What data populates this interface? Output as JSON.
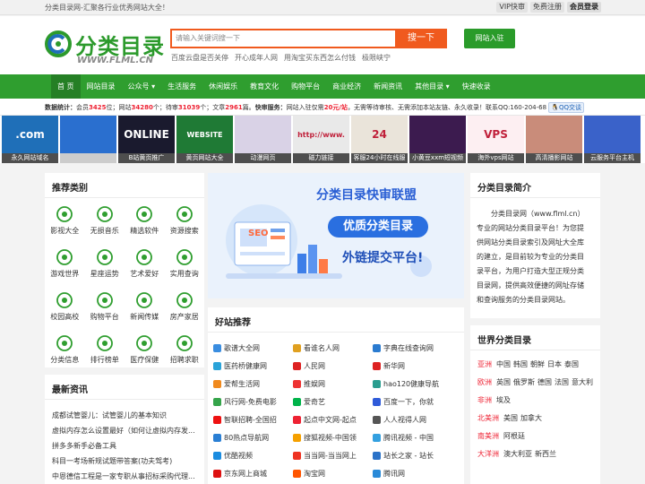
{
  "topbar": {
    "slogan": "分类目录网-汇聚各行业优秀网站大全！",
    "links": [
      "VIP快审",
      "免费注册",
      "会员登录"
    ]
  },
  "header": {
    "logo_cn": "分类目录",
    "logo_url": "WWW.FLML.CN",
    "search_placeholder": "请输入关键词搜一下",
    "search_button": "搜一下",
    "hotwords": [
      "百度云盘是否关停",
      "开心成年人网",
      "用淘宝买东西怎么付钱",
      "极限峡宁"
    ],
    "join_button": "网站入驻"
  },
  "nav": {
    "items": [
      "首 页",
      "网站目录",
      "公众号 ▾",
      "生活服务",
      "休闲娱乐",
      "教育文化",
      "购物平台",
      "商业经济",
      "新闻资讯",
      "其他目录 ▾",
      "快速收录"
    ]
  },
  "stats": {
    "label": "数据统计：",
    "members_pre": "会员",
    "members": "3425",
    "members_post": "位；网站",
    "sites": "34280",
    "sites_post": "个；待审",
    "pending": "31039",
    "pending_post": "个；文章",
    "articles": "2961",
    "articles_post": "篇。",
    "fast_label": "快审服务：",
    "fast_pre": "网站入驻仅需",
    "price": "20元/站",
    "fast_post": "，无需等待审核、无需添加本站友链、永久收录！联系QQ:160-204-68",
    "qq_button": "QQ交谈"
  },
  "banners": [
    {
      "caption": "永久网站域名",
      "bg": "#1f6fb8",
      "art": ".com"
    },
    {
      "caption": "",
      "bg": "#2a6fcf",
      "art": ""
    },
    {
      "caption": "B站黄页推广",
      "bg": "#1a1a2e",
      "art": "ONLINE"
    },
    {
      "caption": "黄页网站大全",
      "bg": "#1f7a35",
      "art": "WEBSITE"
    },
    {
      "caption": "动漫网页",
      "bg": "#d9d2e6",
      "art": ""
    },
    {
      "caption": "磁力链接",
      "bg": "#e9e9e9",
      "art": "http://www."
    },
    {
      "caption": "客服24小时在线服",
      "bg": "#eae4da",
      "art": "24"
    },
    {
      "caption": "小黄豆xxm短视频",
      "bg": "#3c1b4f",
      "art": ""
    },
    {
      "caption": "海外vps网站",
      "bg": "#fdeff2",
      "art": "VPS"
    },
    {
      "caption": "高清播影网站",
      "bg": "#c98c7a",
      "art": ""
    },
    {
      "caption": "云服务平台主机",
      "bg": "#3a62c9",
      "art": ""
    }
  ],
  "recommend": {
    "title": "推荐类别",
    "items": [
      {
        "label": "影视大全",
        "icon": "film-reel-icon"
      },
      {
        "label": "无损音乐",
        "icon": "music-note-icon"
      },
      {
        "label": "精选软件",
        "icon": "cloud-download-icon"
      },
      {
        "label": "资源搜索",
        "icon": "search-icon"
      },
      {
        "label": "游戏世界",
        "icon": "soccer-ball-icon"
      },
      {
        "label": "星座运势",
        "icon": "horoscope-icon"
      },
      {
        "label": "艺术爱好",
        "icon": "palette-icon"
      },
      {
        "label": "实用查询",
        "icon": "magnifier-icon"
      },
      {
        "label": "校园高校",
        "icon": "school-icon"
      },
      {
        "label": "购物平台",
        "icon": "cart-icon"
      },
      {
        "label": "新闻传媒",
        "icon": "newspaper-icon"
      },
      {
        "label": "房产家居",
        "icon": "house-icon"
      },
      {
        "label": "分类信息",
        "icon": "chat-bubble-icon"
      },
      {
        "label": "排行榜单",
        "icon": "bar-chart-icon"
      },
      {
        "label": "医疗保健",
        "icon": "caduceus-icon"
      },
      {
        "label": "招聘求职",
        "icon": "recruit-icon"
      }
    ]
  },
  "news": {
    "title": "最新资讯",
    "items": [
      "成都试管婴儿：试管婴儿的基本知识",
      "虚拟内存怎么设置最好（如何让虚拟内存发...",
      "拼多多新手必备工具",
      "科目一考场新规试题带答案(功夫驾考)",
      "中恩德信工程是一家专职从事招标采购代理..."
    ]
  },
  "ad": {
    "headline": "分类目录快审联盟",
    "sub": "优质分类目录",
    "sub2": "外链提交平台!",
    "seo": "SEO"
  },
  "good_sites": {
    "title": "好站推荐",
    "items": [
      {
        "name": "歌谱大全网",
        "color": "#3a8de0"
      },
      {
        "name": "看谁名人网",
        "color": "#e0a020"
      },
      {
        "name": "字典在线查询网",
        "color": "#2a7bd0"
      },
      {
        "name": "医药桥健康网",
        "color": "#2aa3d9"
      },
      {
        "name": "人民网",
        "color": "#d22"
      },
      {
        "name": "新华网",
        "color": "#d22"
      },
      {
        "name": "爱帮生活网",
        "color": "#f08a1e"
      },
      {
        "name": "推娱网",
        "color": "#e33"
      },
      {
        "name": "hao120健康导航",
        "color": "#2a9d8f"
      },
      {
        "name": "风行网-免费电影",
        "color": "#35a44a"
      },
      {
        "name": "爱奇艺",
        "color": "#00b34a"
      },
      {
        "name": "百度一下，你就",
        "color": "#2f5bd9"
      },
      {
        "name": "智联招聘-全国招",
        "color": "#e11"
      },
      {
        "name": "起点中文网-起点",
        "color": "#e23"
      },
      {
        "name": "人人视得人网",
        "color": "#555"
      },
      {
        "name": "80热点导航网",
        "color": "#2a7fd4"
      },
      {
        "name": "搜狐视频-中国领",
        "color": "#f5a000"
      },
      {
        "name": "腾讯视频 - 中国",
        "color": "#33a0e0"
      },
      {
        "name": "优酷视频",
        "color": "#1a8ce0"
      },
      {
        "name": "当当网-当当网上",
        "color": "#e32"
      },
      {
        "name": "站长之家 - 站长",
        "color": "#2a72c8"
      },
      {
        "name": "京东网上商城",
        "color": "#d11"
      },
      {
        "name": "淘宝网",
        "color": "#f50"
      },
      {
        "name": "腾讯网",
        "color": "#2a8ad8"
      }
    ]
  },
  "intro": {
    "title": "分类目录简介",
    "text": "分类目录网（www.flml.cn）专业的网站分类目录平台！为您提供网站分类目录索引及网址大全库的建立，是目前较为专业的分类目录平台，为用户打造大型正规分类目录网，提供高效便捷的网址存储和查询服务的分类目录网站。"
  },
  "world": {
    "title": "世界分类目录",
    "rows": [
      {
        "region": "亚洲",
        "countries": [
          "中国",
          "韩国",
          "朝鲜",
          "日本",
          "泰国"
        ]
      },
      {
        "region": "欧洲",
        "countries": [
          "英国",
          "俄罗斯",
          "德国",
          "法国",
          "意大利"
        ]
      },
      {
        "region": "非洲",
        "countries": [
          "埃及"
        ]
      },
      {
        "region": "北美洲",
        "countries": [
          "美国",
          "加拿大"
        ]
      },
      {
        "region": "南美洲",
        "countries": [
          "阿根廷"
        ]
      },
      {
        "region": "大洋洲",
        "countries": [
          "澳大利亚",
          "新西兰"
        ]
      }
    ]
  },
  "colors": {
    "brand_green": "#2f9e2f",
    "search_orange": "#f05a1e",
    "accent_red": "#e23"
  }
}
